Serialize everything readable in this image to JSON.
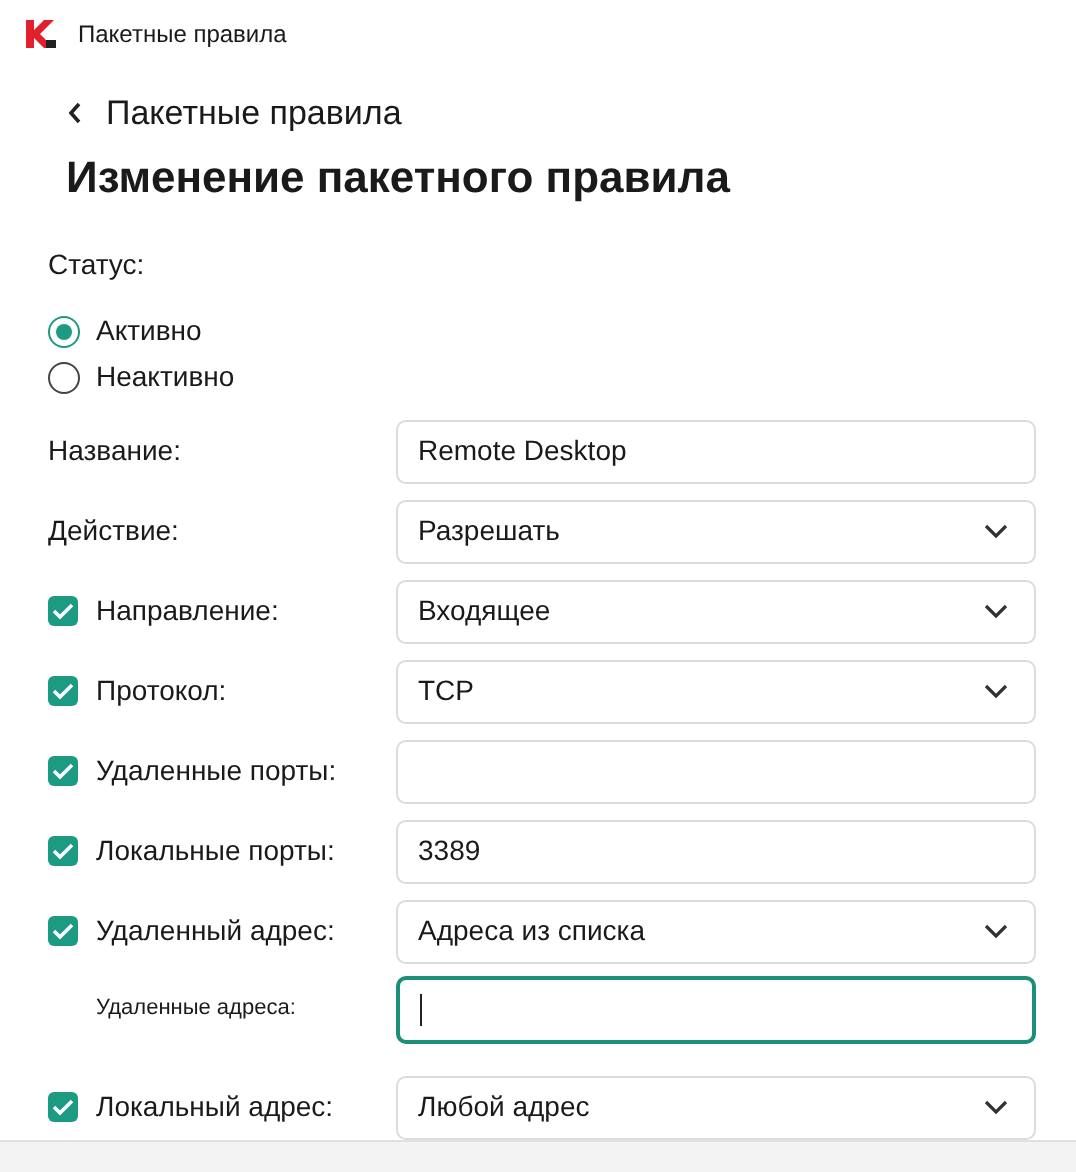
{
  "window": {
    "title": "Пакетные правила"
  },
  "back_link": {
    "label": "Пакетные правила"
  },
  "heading": "Изменение пакетного правила",
  "status": {
    "label": "Статус:",
    "options": [
      {
        "label": "Активно",
        "selected": true
      },
      {
        "label": "Неактивно",
        "selected": false
      }
    ]
  },
  "rows": [
    {
      "kind": "plain",
      "label": "Название:",
      "field": {
        "kind": "input",
        "value": "Remote Desktop",
        "focused": false
      }
    },
    {
      "kind": "plain",
      "label": "Действие:",
      "field": {
        "kind": "select",
        "value": "Разрешать",
        "focused": false
      }
    },
    {
      "kind": "checkbox",
      "checked": true,
      "label": "Направление:",
      "field": {
        "kind": "select",
        "value": "Входящее",
        "focused": false
      }
    },
    {
      "kind": "checkbox",
      "checked": true,
      "label": "Протокол:",
      "field": {
        "kind": "select",
        "value": "TCP",
        "focused": false
      }
    },
    {
      "kind": "checkbox",
      "checked": true,
      "label": "Удаленные порты:",
      "field": {
        "kind": "input",
        "focused": false
      }
    },
    {
      "kind": "checkbox",
      "checked": true,
      "label": "Локальные порты:",
      "field": {
        "kind": "input",
        "value": "3389",
        "focused": false
      }
    },
    {
      "kind": "checkbox",
      "checked": true,
      "label": "Удаленный адрес:",
      "field": {
        "kind": "select",
        "value": "Адреса из списка",
        "focused": false
      }
    },
    {
      "kind": "sub",
      "label": "Удаленные адреса:",
      "field": {
        "kind": "input",
        "focused": true
      }
    },
    {
      "kind": "checkbox",
      "checked": true,
      "label": "Локальный адрес:",
      "field": {
        "kind": "select",
        "value": "Любой адрес",
        "focused": false
      }
    }
  ]
}
